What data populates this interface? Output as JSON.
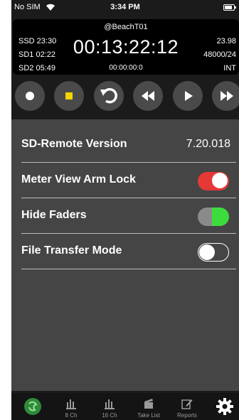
{
  "status_bar": {
    "carrier": "No SIM",
    "time": "3:34 PM"
  },
  "timecode_panel": {
    "device_name": "@BeachT01",
    "ssd": "SSD 23:30",
    "sd1": "SD1 02:22",
    "sd2": "SD2 05:49",
    "timecode": "00:13:22:12",
    "sub_timecode": "00:00:00:0",
    "frame_rate": "23.98",
    "sample_rate": "48000/24",
    "sync": "INT"
  },
  "transport": {
    "buttons": [
      "record",
      "stop",
      "undo",
      "rewind",
      "play",
      "fast-forward"
    ],
    "stop_color": "#f5d400"
  },
  "settings": {
    "version_label": "SD-Remote Version",
    "version_value": "7.20.018",
    "arm_lock_label": "Meter View Arm Lock",
    "arm_lock_on": true,
    "arm_lock_color": "#e53935",
    "hide_faders_label": "Hide Faders",
    "hide_faders_on": true,
    "hide_faders_color": "#3ddc3d",
    "file_transfer_label": "File Transfer Mode",
    "file_transfer_on": false
  },
  "tabs": [
    {
      "name": "logo",
      "label": ""
    },
    {
      "name": "8ch",
      "label": "8 Ch"
    },
    {
      "name": "16ch",
      "label": "16 Ch"
    },
    {
      "name": "take-list",
      "label": "Take List"
    },
    {
      "name": "reports",
      "label": "Reports"
    },
    {
      "name": "settings",
      "label": ""
    }
  ]
}
